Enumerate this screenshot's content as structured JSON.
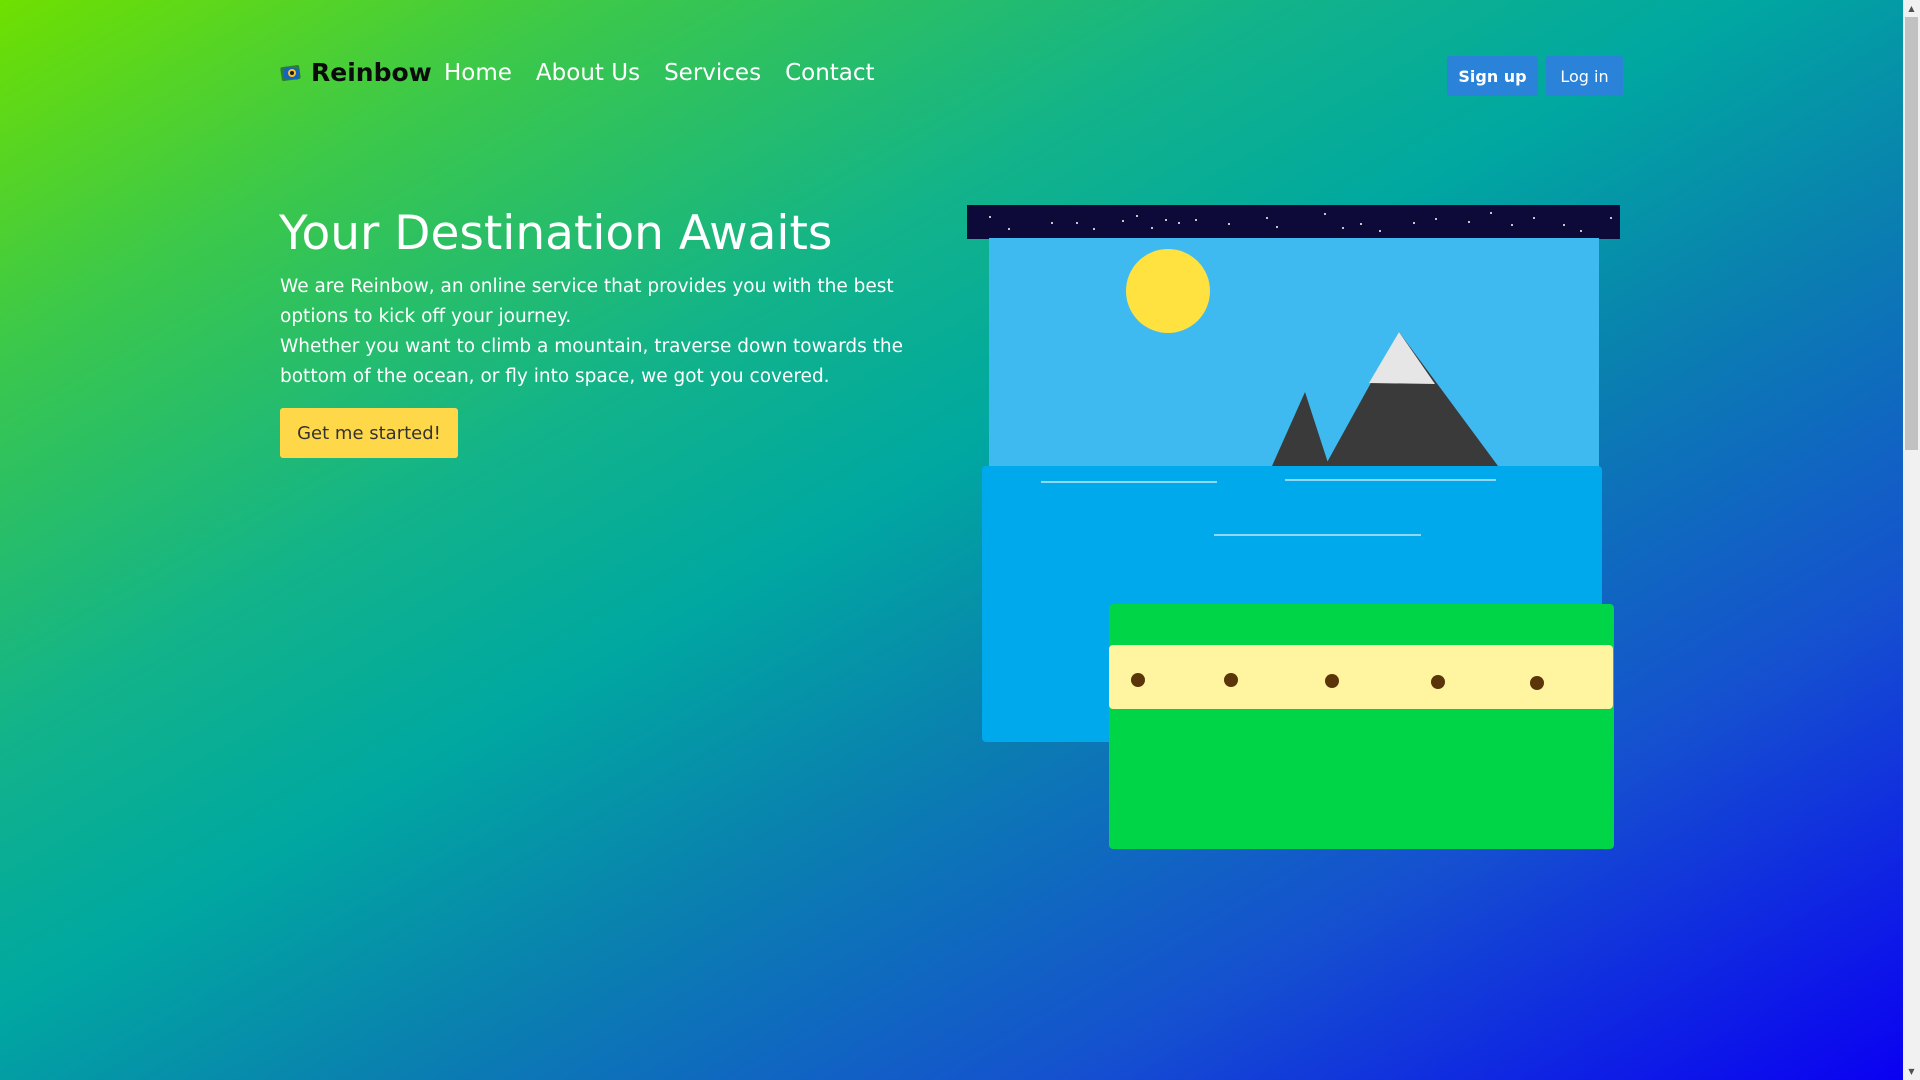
{
  "nav": {
    "brand": "Reinbow",
    "links": [
      "Home",
      "About Us",
      "Services",
      "Contact"
    ],
    "signup_label": "Sign up",
    "login_label": "Log in"
  },
  "hero": {
    "title": "Your Destination Awaits",
    "paragraph_1": "We are Reinbow, an online service that provides you with the best options to kick off your journey.",
    "paragraph_2": "Whether you want to climb a mountain, traverse down towards the bottom of the ocean, or fly into space, we got you covered.",
    "cta_label": "Get me started!"
  },
  "colors": {
    "accent_button": "#2b82d9",
    "cta": "#ffd84a",
    "space": "#0d0a3a",
    "sky": "#3fbaf0",
    "ocean": "#00a8ec",
    "sand": "#fff4a0",
    "grass": "#00d447"
  }
}
